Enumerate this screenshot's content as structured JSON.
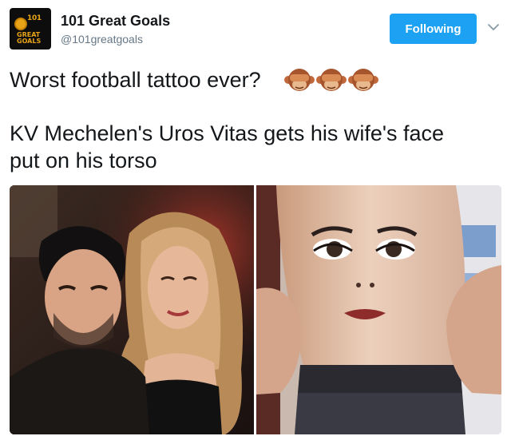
{
  "tweet": {
    "display_name": "101 Great Goals",
    "handle": "@101greatgoals",
    "follow_button": "Following",
    "text_line_1": "Worst football tattoo ever?",
    "text_line_2": "KV Mechelen's Uros Vitas gets his wife's face",
    "text_line_3": "put on his torso",
    "emoji": [
      "see-no-evil-monkey",
      "see-no-evil-monkey",
      "see-no-evil-monkey"
    ]
  },
  "avatar": {
    "brand_top": "101",
    "brand_mid": "GREAT",
    "brand_bottom": "GOALS"
  },
  "colors": {
    "follow_button": "#1da1f2",
    "handle": "#657786",
    "text": "#14171a"
  }
}
